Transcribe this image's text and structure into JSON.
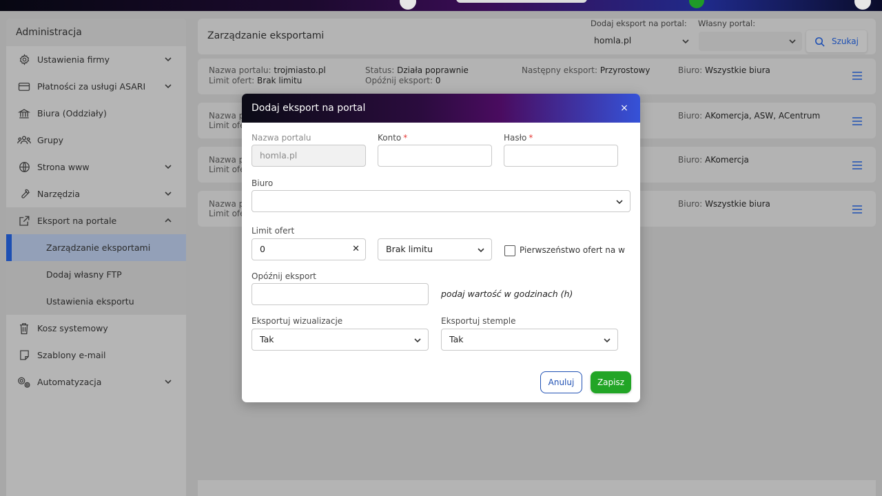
{
  "sidebar": {
    "title": "Administracja",
    "items": [
      {
        "label": "Ustawienia firmy",
        "icon": "gear-icon"
      },
      {
        "label": "Płatności za usługi ASARI",
        "icon": "credit-card-icon"
      },
      {
        "label": "Biura (Oddziały)",
        "icon": "bank-icon"
      },
      {
        "label": "Grupy",
        "icon": "users-icon"
      },
      {
        "label": "Strona www",
        "icon": "globe-icon"
      },
      {
        "label": "Narzędzia",
        "icon": "wrench-icon"
      },
      {
        "label": "Eksport na portale",
        "icon": "export-icon"
      },
      {
        "label": "Zarządzanie eksportami"
      },
      {
        "label": "Dodaj własny FTP"
      },
      {
        "label": "Ustawienia eksportu"
      },
      {
        "label": "Kosz systemowy",
        "icon": "trash-icon"
      },
      {
        "label": "Szablony e-mail",
        "icon": "email-template-icon"
      },
      {
        "label": "Automatyzacja",
        "icon": "automation-icon"
      }
    ]
  },
  "header": {
    "title": "Zarządzanie eksportami",
    "add_export_label": "Dodaj eksport na portal:",
    "add_export_value": "homla.pl",
    "own_portal_label": "Własny portal:",
    "own_portal_value": "",
    "search_label": "Szukaj"
  },
  "labels": {
    "portal_name": "Nazwa portalu:",
    "limit": "Limit ofert:",
    "status": "Status:",
    "delay": "Opóźnij eksport:",
    "next_export": "Następny eksport:",
    "office": "Biuro:",
    "portal_name_trunc": "Nazwa p",
    "limit_trunc": "Limit ofe"
  },
  "exports": [
    {
      "portal": "trojmiasto.pl",
      "limit": "Brak limitu",
      "status": "Działa poprawnie",
      "delay": "0",
      "next": "Przyrostowy",
      "office": "Wszystkie biura"
    },
    {
      "office": "AKomercja, ASW, ACentrum"
    },
    {
      "office": "AKomercja"
    },
    {
      "office": "Wszystkie biura"
    }
  ],
  "modal": {
    "title": "Dodaj eksport na portal",
    "portal_name_label": "Nazwa portalu",
    "portal_name_value": "homla.pl",
    "account_label": "Konto",
    "password_label": "Hasło",
    "required_mark": "*",
    "office_label": "Biuro",
    "limit_label": "Limit ofert",
    "limit_value": "0",
    "limit_type_value": "Brak limitu",
    "priority_label": "Pierwszeństwo ofert na w",
    "delay_label": "Opóźnij eksport",
    "delay_hint": "podaj wartość w godzinach (h)",
    "visualizations_label": "Eksportuj wizualizacje",
    "visualizations_value": "Tak",
    "stamps_label": "Eksportuj stemple",
    "stamps_value": "Tak",
    "cancel_label": "Anuluj",
    "save_label": "Zapisz",
    "close_symbol": "×",
    "clear_symbol": "✕"
  },
  "colors": {
    "accent": "#1d4fb3",
    "save": "#22a526",
    "required": "#e53935"
  }
}
